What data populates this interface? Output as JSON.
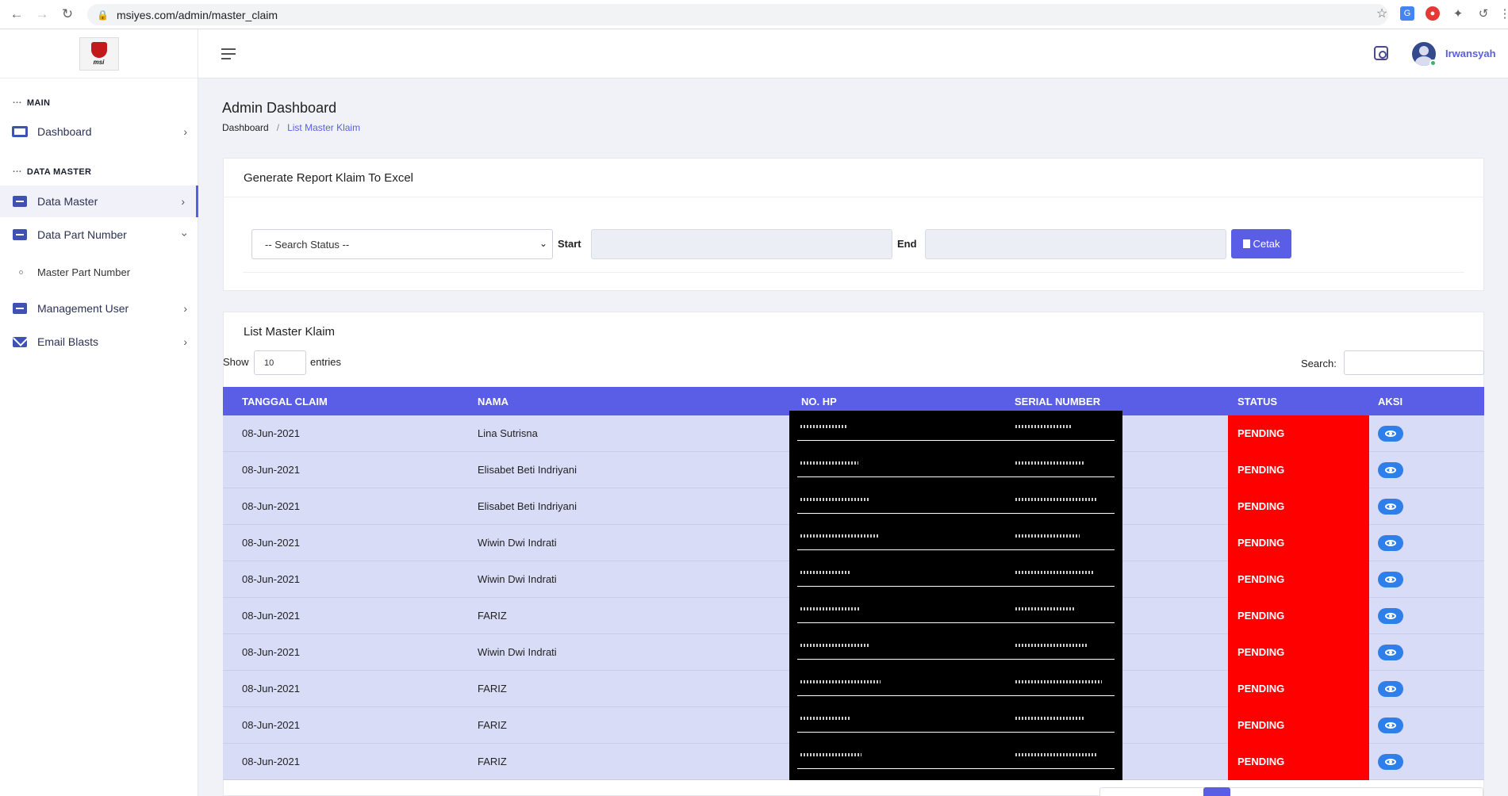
{
  "browser": {
    "url": "msiyes.com/admin/master_claim"
  },
  "sidebar": {
    "logo_text": "msi",
    "sections": {
      "main": "MAIN",
      "data_master": "DATA MASTER"
    },
    "items": [
      {
        "label": "Dashboard",
        "icon": "monitor-icon"
      },
      {
        "label": "Data Master",
        "icon": "folder-icon"
      },
      {
        "label": "Data Part Number",
        "icon": "folder-icon"
      },
      {
        "label": "Management User",
        "icon": "folder-icon"
      },
      {
        "label": "Email Blasts",
        "icon": "mail-icon"
      }
    ],
    "submenu": {
      "label": "Master Part Number"
    }
  },
  "header": {
    "username": "Irwansyah"
  },
  "page": {
    "title": "Admin Dashboard",
    "breadcrumb_root": "Dashboard",
    "breadcrumb_current": "List Master Klaim"
  },
  "report": {
    "title": "Generate Report Klaim To Excel",
    "status_placeholder": "-- Search Status --",
    "start_label": "Start",
    "end_label": "End",
    "button_label": "Cetak"
  },
  "list": {
    "title": "List Master Klaim",
    "show_label": "Show",
    "entries_value": "10",
    "entries_label": "entries",
    "search_label": "Search:",
    "columns": {
      "date": "TANGGAL CLAIM",
      "name": "NAMA",
      "phone": "NO. HP",
      "serial": "SERIAL NUMBER",
      "status": "STATUS",
      "action": "AKSI"
    },
    "rows": [
      {
        "date": "08-Jun-2021",
        "name": "Lina Sutrisna",
        "status": "PENDING"
      },
      {
        "date": "08-Jun-2021",
        "name": "Elisabet Beti Indriyani",
        "status": "PENDING"
      },
      {
        "date": "08-Jun-2021",
        "name": "Elisabet Beti Indriyani",
        "status": "PENDING"
      },
      {
        "date": "08-Jun-2021",
        "name": "Wiwin Dwi Indrati",
        "status": "PENDING"
      },
      {
        "date": "08-Jun-2021",
        "name": "Wiwin Dwi Indrati",
        "status": "PENDING"
      },
      {
        "date": "08-Jun-2021",
        "name": "FARIZ",
        "status": "PENDING"
      },
      {
        "date": "08-Jun-2021",
        "name": "Wiwin Dwi Indrati",
        "status": "PENDING"
      },
      {
        "date": "08-Jun-2021",
        "name": "FARIZ",
        "status": "PENDING"
      },
      {
        "date": "08-Jun-2021",
        "name": "FARIZ",
        "status": "PENDING"
      },
      {
        "date": "08-Jun-2021",
        "name": "FARIZ",
        "status": "PENDING"
      }
    ]
  },
  "colors": {
    "accent": "#5a5ee6",
    "row_bg": "#d9dcf7",
    "status_pending": "#ff0000",
    "action_button": "#2f7fea"
  }
}
